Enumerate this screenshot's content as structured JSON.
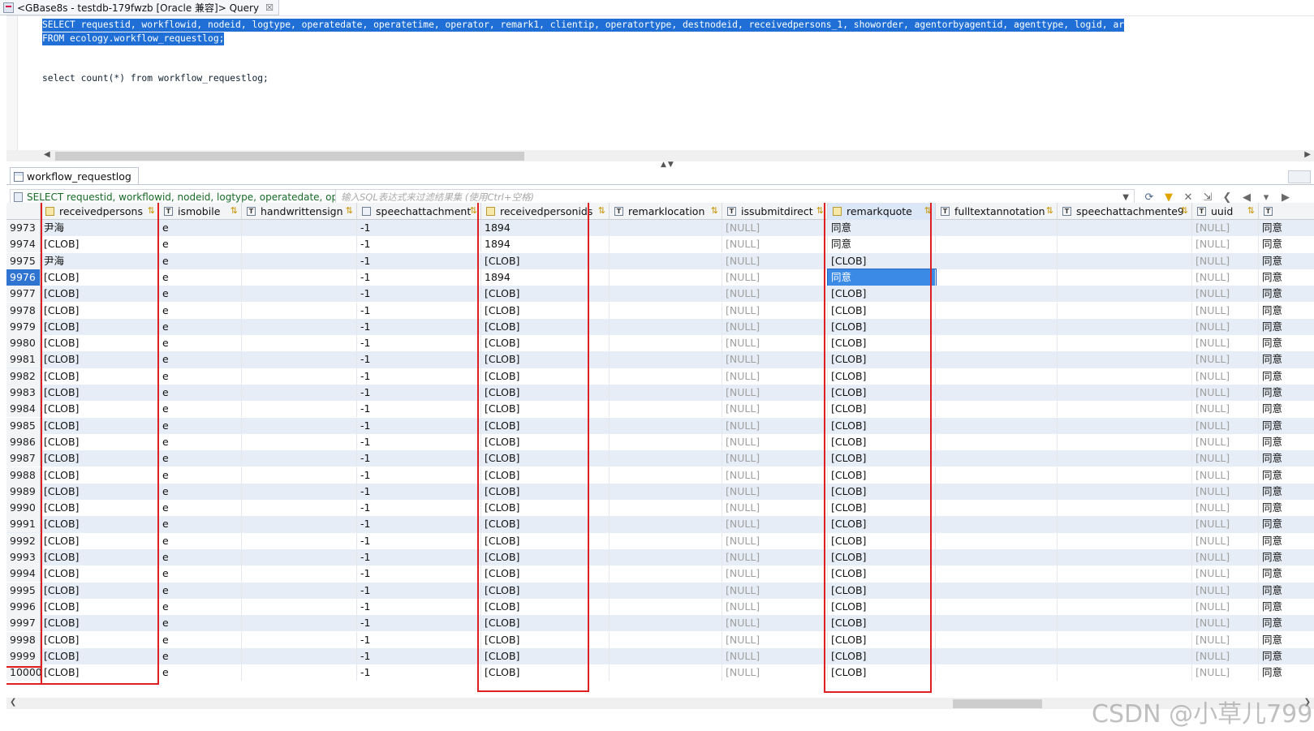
{
  "editor_tab": {
    "title": "<GBase8s - testdb-179fwzb [Oracle 兼容]> Query",
    "close": "☒"
  },
  "editor": {
    "line1": "SELECT requestid, workflowid, nodeid, logtype, operatedate, operatetime, operator, remark1, clientip, operatortype, destnodeid, receivedpersons_1, showorder, agentorbyagentid, agenttype, logid, ar",
    "line2": "FROM ecology.workflow_requestlog;",
    "line3": "select count(*) from workflow_requestlog;"
  },
  "result_tab": {
    "label": "workflow_requestlog"
  },
  "filter": {
    "query": "SELECT requestid, workflowid, nodeid, logtype, operatedate, ope",
    "placeholder": "输入SQL表达式来过滤结果集 (使用Ctrl+空格)"
  },
  "columns": [
    {
      "name": "receivedpersons",
      "type": "clob"
    },
    {
      "name": "ismobile",
      "type": "text"
    },
    {
      "name": "handwrittensign",
      "type": "text"
    },
    {
      "name": "speechattachment",
      "type": "media"
    },
    {
      "name": "receivedpersonids",
      "type": "clob"
    },
    {
      "name": "remarklocation",
      "type": "text"
    },
    {
      "name": "issubmitdirect",
      "type": "text"
    },
    {
      "name": "remarkquote",
      "type": "clob"
    },
    {
      "name": "fulltextannotation",
      "type": "text"
    },
    {
      "name": "speechattachmente9",
      "type": "text"
    },
    {
      "name": "uuid",
      "type": "text"
    },
    {
      "name": "",
      "type": "text"
    }
  ],
  "rows": [
    {
      "n": "9973",
      "rp": "尹海",
      "im": "e",
      "sa": "-1",
      "rpi": "1894",
      "isd": "[NULL]",
      "rq": "同意",
      "uuid": "[NULL]",
      "last": "同意"
    },
    {
      "n": "9974",
      "rp": "[CLOB]",
      "im": "e",
      "sa": "-1",
      "rpi": "1894",
      "isd": "[NULL]",
      "rq": "同意",
      "uuid": "[NULL]",
      "last": "同意"
    },
    {
      "n": "9975",
      "rp": "尹海",
      "im": "e",
      "sa": "-1",
      "rpi": "[CLOB]",
      "isd": "[NULL]",
      "rq": "[CLOB]",
      "uuid": "[NULL]",
      "last": "同意"
    },
    {
      "n": "9976",
      "rp": "[CLOB]",
      "im": "e",
      "sa": "-1",
      "rpi": "1894",
      "isd": "[NULL]",
      "rq": "同意",
      "uuid": "[NULL]",
      "last": "同意"
    },
    {
      "n": "9977",
      "rp": "[CLOB]",
      "im": "e",
      "sa": "-1",
      "rpi": "[CLOB]",
      "isd": "[NULL]",
      "rq": "[CLOB]",
      "uuid": "[NULL]",
      "last": "同意"
    },
    {
      "n": "9978",
      "rp": "[CLOB]",
      "im": "e",
      "sa": "-1",
      "rpi": "[CLOB]",
      "isd": "[NULL]",
      "rq": "[CLOB]",
      "uuid": "[NULL]",
      "last": "同意"
    },
    {
      "n": "9979",
      "rp": "[CLOB]",
      "im": "e",
      "sa": "-1",
      "rpi": "[CLOB]",
      "isd": "[NULL]",
      "rq": "[CLOB]",
      "uuid": "[NULL]",
      "last": "同意"
    },
    {
      "n": "9980",
      "rp": "[CLOB]",
      "im": "e",
      "sa": "-1",
      "rpi": "[CLOB]",
      "isd": "[NULL]",
      "rq": "[CLOB]",
      "uuid": "[NULL]",
      "last": "同意"
    },
    {
      "n": "9981",
      "rp": "[CLOB]",
      "im": "e",
      "sa": "-1",
      "rpi": "[CLOB]",
      "isd": "[NULL]",
      "rq": "[CLOB]",
      "uuid": "[NULL]",
      "last": "同意"
    },
    {
      "n": "9982",
      "rp": "[CLOB]",
      "im": "e",
      "sa": "-1",
      "rpi": "[CLOB]",
      "isd": "[NULL]",
      "rq": "[CLOB]",
      "uuid": "[NULL]",
      "last": "同意"
    },
    {
      "n": "9983",
      "rp": "[CLOB]",
      "im": "e",
      "sa": "-1",
      "rpi": "[CLOB]",
      "isd": "[NULL]",
      "rq": "[CLOB]",
      "uuid": "[NULL]",
      "last": "同意"
    },
    {
      "n": "9984",
      "rp": "[CLOB]",
      "im": "e",
      "sa": "-1",
      "rpi": "[CLOB]",
      "isd": "[NULL]",
      "rq": "[CLOB]",
      "uuid": "[NULL]",
      "last": "同意"
    },
    {
      "n": "9985",
      "rp": "[CLOB]",
      "im": "e",
      "sa": "-1",
      "rpi": "[CLOB]",
      "isd": "[NULL]",
      "rq": "[CLOB]",
      "uuid": "[NULL]",
      "last": "同意"
    },
    {
      "n": "9986",
      "rp": "[CLOB]",
      "im": "e",
      "sa": "-1",
      "rpi": "[CLOB]",
      "isd": "[NULL]",
      "rq": "[CLOB]",
      "uuid": "[NULL]",
      "last": "同意"
    },
    {
      "n": "9987",
      "rp": "[CLOB]",
      "im": "e",
      "sa": "-1",
      "rpi": "[CLOB]",
      "isd": "[NULL]",
      "rq": "[CLOB]",
      "uuid": "[NULL]",
      "last": "同意"
    },
    {
      "n": "9988",
      "rp": "[CLOB]",
      "im": "e",
      "sa": "-1",
      "rpi": "[CLOB]",
      "isd": "[NULL]",
      "rq": "[CLOB]",
      "uuid": "[NULL]",
      "last": "同意"
    },
    {
      "n": "9989",
      "rp": "[CLOB]",
      "im": "e",
      "sa": "-1",
      "rpi": "[CLOB]",
      "isd": "[NULL]",
      "rq": "[CLOB]",
      "uuid": "[NULL]",
      "last": "同意"
    },
    {
      "n": "9990",
      "rp": "[CLOB]",
      "im": "e",
      "sa": "-1",
      "rpi": "[CLOB]",
      "isd": "[NULL]",
      "rq": "[CLOB]",
      "uuid": "[NULL]",
      "last": "同意"
    },
    {
      "n": "9991",
      "rp": "[CLOB]",
      "im": "e",
      "sa": "-1",
      "rpi": "[CLOB]",
      "isd": "[NULL]",
      "rq": "[CLOB]",
      "uuid": "[NULL]",
      "last": "同意"
    },
    {
      "n": "9992",
      "rp": "[CLOB]",
      "im": "e",
      "sa": "-1",
      "rpi": "[CLOB]",
      "isd": "[NULL]",
      "rq": "[CLOB]",
      "uuid": "[NULL]",
      "last": "同意"
    },
    {
      "n": "9993",
      "rp": "[CLOB]",
      "im": "e",
      "sa": "-1",
      "rpi": "[CLOB]",
      "isd": "[NULL]",
      "rq": "[CLOB]",
      "uuid": "[NULL]",
      "last": "同意"
    },
    {
      "n": "9994",
      "rp": "[CLOB]",
      "im": "e",
      "sa": "-1",
      "rpi": "[CLOB]",
      "isd": "[NULL]",
      "rq": "[CLOB]",
      "uuid": "[NULL]",
      "last": "同意"
    },
    {
      "n": "9995",
      "rp": "[CLOB]",
      "im": "e",
      "sa": "-1",
      "rpi": "[CLOB]",
      "isd": "[NULL]",
      "rq": "[CLOB]",
      "uuid": "[NULL]",
      "last": "同意"
    },
    {
      "n": "9996",
      "rp": "[CLOB]",
      "im": "e",
      "sa": "-1",
      "rpi": "[CLOB]",
      "isd": "[NULL]",
      "rq": "[CLOB]",
      "uuid": "[NULL]",
      "last": "同意"
    },
    {
      "n": "9997",
      "rp": "[CLOB]",
      "im": "e",
      "sa": "-1",
      "rpi": "[CLOB]",
      "isd": "[NULL]",
      "rq": "[CLOB]",
      "uuid": "[NULL]",
      "last": "同意"
    },
    {
      "n": "9998",
      "rp": "[CLOB]",
      "im": "e",
      "sa": "-1",
      "rpi": "[CLOB]",
      "isd": "[NULL]",
      "rq": "[CLOB]",
      "uuid": "[NULL]",
      "last": "同意"
    },
    {
      "n": "9999",
      "rp": "[CLOB]",
      "im": "e",
      "sa": "-1",
      "rpi": "[CLOB]",
      "isd": "[NULL]",
      "rq": "[CLOB]",
      "uuid": "[NULL]",
      "last": "同意"
    },
    {
      "n": "10000",
      "rp": "[CLOB]",
      "im": "e",
      "sa": "-1",
      "rpi": "[CLOB]",
      "isd": "[NULL]",
      "rq": "[CLOB]",
      "uuid": "[NULL]",
      "last": "同意"
    }
  ],
  "selected_row": "9976",
  "watermark": "CSDN @小草儿799",
  "colors": {
    "selection": "#1f6fd6",
    "highlight_box": "#e02020",
    "alt_row": "#e7edf6"
  }
}
